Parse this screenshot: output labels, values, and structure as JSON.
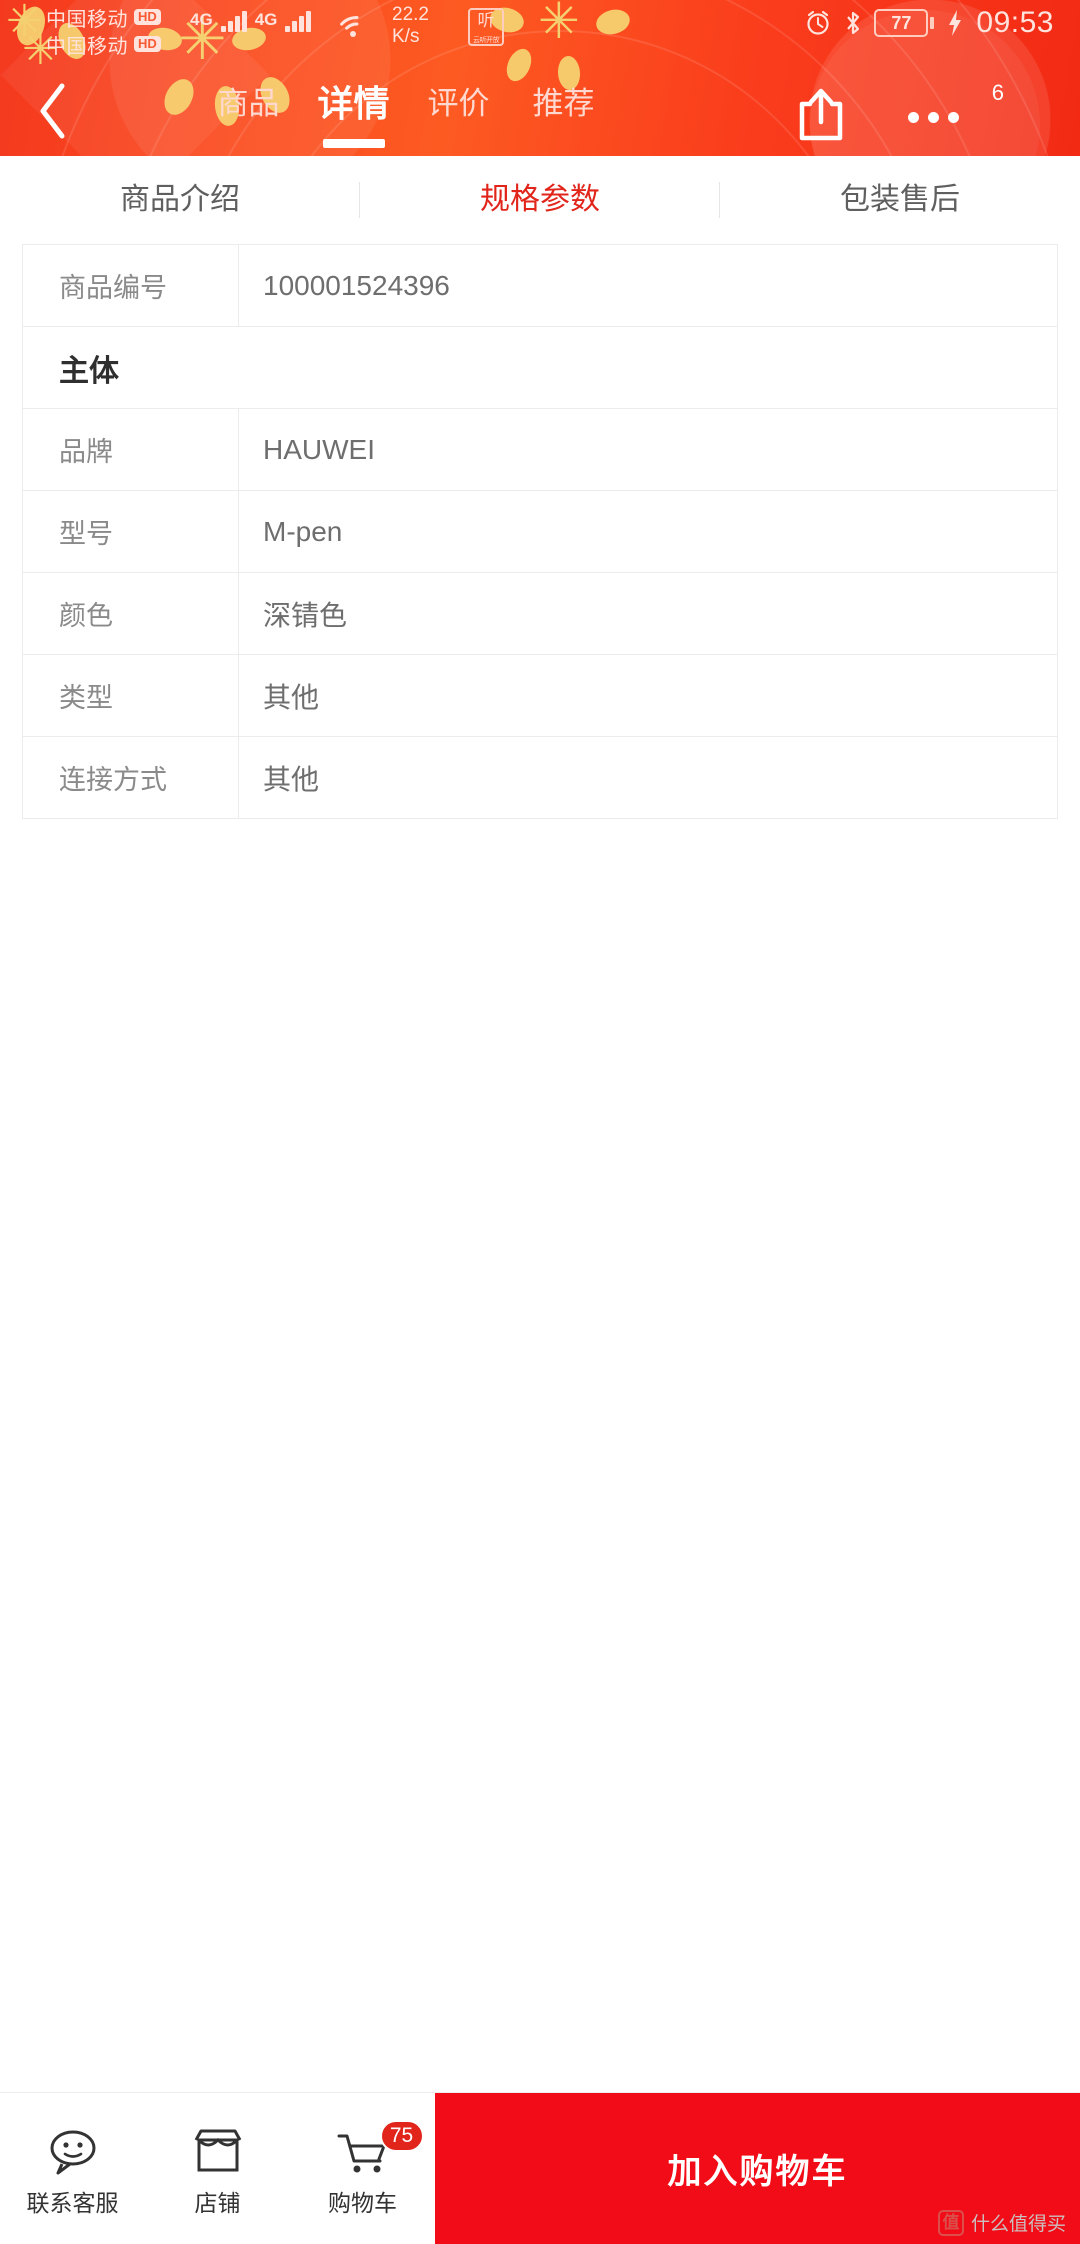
{
  "status_bar": {
    "carrier_1": "中国移动",
    "carrier_2": "中国移动",
    "hd_badge": "HD",
    "network_1": "4G",
    "network_2": "4G",
    "speed_value": "22.2",
    "speed_unit": "K/s",
    "app_icon_label": "听",
    "app_icon_sub": "云听开放",
    "battery_percent": "77",
    "time": "09:53"
  },
  "header": {
    "back_icon": "chevron-left-icon",
    "share_icon": "share-icon",
    "more_icon": "more-dots-icon",
    "more_badge": "6",
    "tabs": [
      {
        "label": "商品",
        "active": false
      },
      {
        "label": "详情",
        "active": true
      },
      {
        "label": "评价",
        "active": false
      },
      {
        "label": "推荐",
        "active": false
      }
    ]
  },
  "subtabs": [
    {
      "label": "商品介绍",
      "active": false
    },
    {
      "label": "规格参数",
      "active": true
    },
    {
      "label": "包装售后",
      "active": false
    }
  ],
  "spec_table": {
    "rows": [
      {
        "type": "item",
        "key": "商品编号",
        "value": "100001524396"
      },
      {
        "type": "section",
        "key": "主体",
        "value": ""
      },
      {
        "type": "item",
        "key": "品牌",
        "value": "HAUWEI"
      },
      {
        "type": "item",
        "key": "型号",
        "value": "M-pen"
      },
      {
        "type": "item",
        "key": "颜色",
        "value": "深锖色"
      },
      {
        "type": "item",
        "key": "类型",
        "value": "其他"
      },
      {
        "type": "item",
        "key": "连接方式",
        "value": "其他"
      }
    ]
  },
  "bottom_bar": {
    "items": [
      {
        "label": "联系客服",
        "icon": "customer-service-icon"
      },
      {
        "label": "店铺",
        "icon": "shop-icon"
      },
      {
        "label": "购物车",
        "icon": "cart-icon",
        "badge": "75"
      }
    ],
    "primary_action": "加入购物车",
    "primary_color": "#f10c17"
  },
  "watermark": {
    "logo": "值",
    "text": "什么值得买"
  },
  "theme": {
    "header_red": "#fb4a1e",
    "accent_red": "#e1251b",
    "gold": "#f5d070"
  }
}
